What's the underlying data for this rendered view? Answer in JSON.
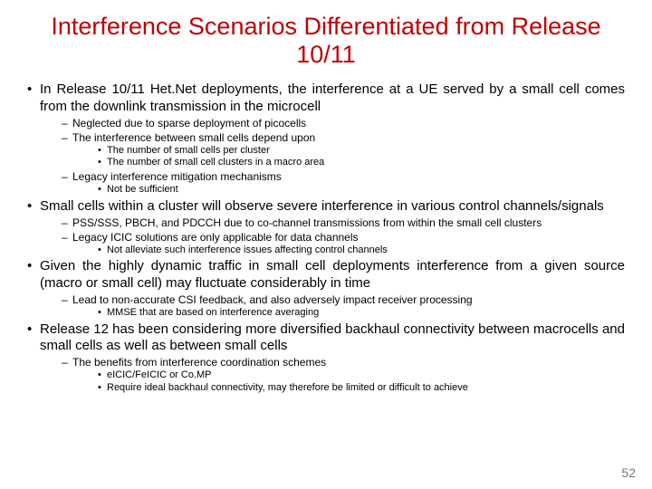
{
  "title": "Interference Scenarios Differentiated from Release 10/11",
  "page_number": "52",
  "b1": {
    "text": "In Release 10/11 Het.Net deployments, the interference at a UE served by a small cell comes from the downlink transmission in the microcell",
    "s1": "Neglected due to sparse deployment of picocells",
    "s2": "The interference between small cells depend upon",
    "s2a": "The number of small cells per cluster",
    "s2b": "The number of small cell clusters in a macro area",
    "s3": "Legacy interference mitigation mechanisms",
    "s3a": "Not be sufficient"
  },
  "b2": {
    "text": "Small cells within a cluster will observe severe interference in various control channels/signals",
    "s1": "PSS/SSS, PBCH, and PDCCH due to co-channel transmissions from within the small cell clusters",
    "s2": "Legacy ICIC solutions are only applicable for data channels",
    "s2a": "Not alleviate such interference issues affecting control channels"
  },
  "b3": {
    "text": "Given the highly dynamic traffic in small cell deployments interference from a given source (macro or small cell) may fluctuate considerably in time",
    "s1": "Lead to non-accurate CSI feedback, and also adversely impact receiver processing",
    "s1a": "MMSE that are based on interference averaging"
  },
  "b4": {
    "text": "Release 12 has been considering more diversified backhaul connectivity between macrocells and small cells as well as between small cells",
    "s1": "The benefits from interference coordination schemes",
    "s1a": "eICIC/FeICIC or Co.MP",
    "s1b": "Require ideal backhaul connectivity, may therefore be limited or difficult to achieve"
  }
}
